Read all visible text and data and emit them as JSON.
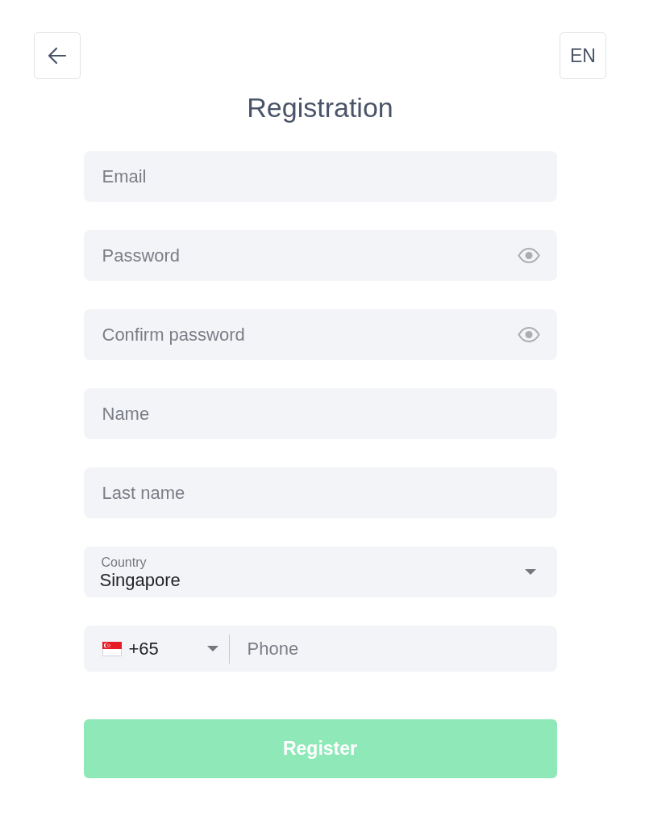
{
  "header": {
    "language_button": {
      "label": "EN"
    }
  },
  "title": "Registration",
  "fields": [
    {
      "kind": "text",
      "placeholder": "Email"
    },
    {
      "kind": "password",
      "placeholder": "Password"
    },
    {
      "kind": "password",
      "placeholder": "Confirm password"
    },
    {
      "kind": "text",
      "placeholder": "Name"
    },
    {
      "kind": "text",
      "placeholder": "Last name"
    },
    {
      "kind": "select",
      "label": "Country",
      "value": "Singapore"
    },
    {
      "kind": "phone",
      "code": "+65",
      "placeholder": "Phone"
    }
  ],
  "submit_button": {
    "label": "Register",
    "disabled": true
  }
}
